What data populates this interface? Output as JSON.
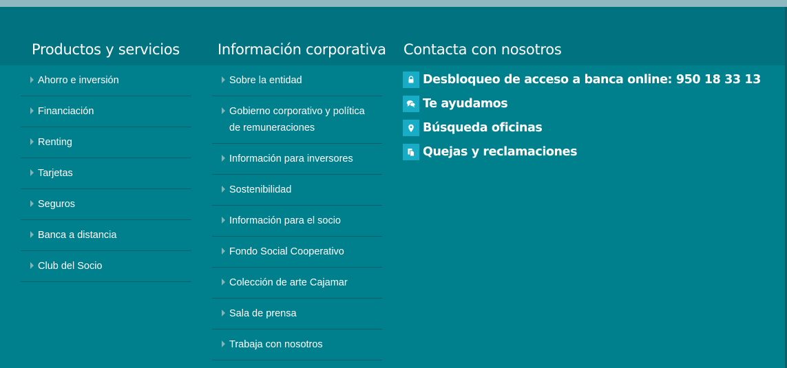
{
  "productos": {
    "title": "Productos y servicios",
    "items": [
      {
        "label": "Ahorro e inversión"
      },
      {
        "label": "Financiación"
      },
      {
        "label": "Renting"
      },
      {
        "label": "Tarjetas"
      },
      {
        "label": "Seguros"
      },
      {
        "label": "Banca a distancia"
      },
      {
        "label": "Club del Socio"
      }
    ]
  },
  "corporativa": {
    "title": "Información corporativa",
    "items": [
      {
        "label": "Sobre la entidad"
      },
      {
        "label": "Gobierno corporativo y política de remuneraciones"
      },
      {
        "label": "Información para inversores"
      },
      {
        "label": "Sostenibilidad"
      },
      {
        "label": "Información para el socio"
      },
      {
        "label": "Fondo Social Cooperativo"
      },
      {
        "label": "Colección de arte Cajamar"
      },
      {
        "label": "Sala de prensa"
      },
      {
        "label": "Trabaja con nosotros"
      }
    ]
  },
  "contacto": {
    "title": "Contacta con nosotros",
    "items": [
      {
        "label": "Desbloqueo de acceso a banca online: 950 18 33 13",
        "icon": "lock-icon"
      },
      {
        "label": "Te ayudamos",
        "icon": "chat-icon"
      },
      {
        "label": "Búsqueda oficinas",
        "icon": "map-pin-icon"
      },
      {
        "label": "Quejas y reclamaciones",
        "icon": "document-icon"
      }
    ]
  },
  "colors": {
    "background": "#007f8c",
    "header_band": "#007280",
    "divider": "#0a5f69",
    "icon_bg": "#18acc6",
    "caret": "#7fb5bc",
    "text": "#ffffff"
  }
}
